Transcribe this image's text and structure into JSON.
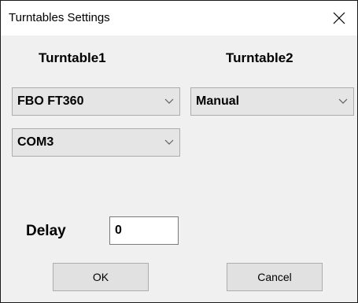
{
  "window": {
    "title": "Turntables Settings",
    "close_icon": "close-icon"
  },
  "turntable1": {
    "label": "Turntable1",
    "model_selected": "FBO FT360",
    "port_selected": "COM3"
  },
  "turntable2": {
    "label": "Turntable2",
    "model_selected": "Manual"
  },
  "delay": {
    "label": "Delay",
    "value": "0"
  },
  "buttons": {
    "ok_label": "OK",
    "cancel_label": "Cancel"
  },
  "colors": {
    "window_bg": "#f0f0f0",
    "titlebar_bg": "#ffffff",
    "combo_bg": "#e5e5e5",
    "button_bg": "#e1e1e1",
    "border": "#adadad"
  }
}
